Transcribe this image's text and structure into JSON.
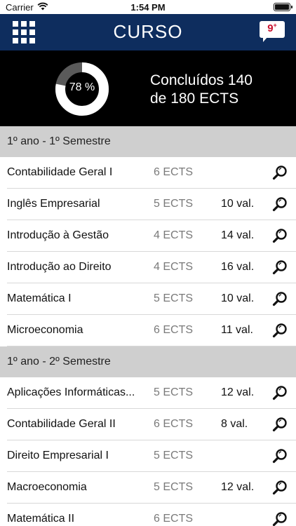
{
  "status_bar": {
    "carrier": "Carrier",
    "time": "1:54 PM"
  },
  "nav": {
    "title": "CURSO",
    "notification_count": "9",
    "notification_suffix": "+"
  },
  "progress": {
    "percent_label": "78 %",
    "percent": 78,
    "line1": "Concluídos 140",
    "line2": "de 180 ECTS"
  },
  "sections": [
    {
      "title": "1º ano - 1º Semestre",
      "courses": [
        {
          "name": "Contabilidade Geral I",
          "ects": "6 ECTS",
          "grade": ""
        },
        {
          "name": "Inglês Empresarial",
          "ects": "5 ECTS",
          "grade": "10 val."
        },
        {
          "name": "Introdução à Gestão",
          "ects": "4 ECTS",
          "grade": "14 val."
        },
        {
          "name": "Introdução ao Direito",
          "ects": "4 ECTS",
          "grade": "16 val."
        },
        {
          "name": "Matemática I",
          "ects": "5 ECTS",
          "grade": "10 val."
        },
        {
          "name": "Microeconomia",
          "ects": "6 ECTS",
          "grade": "11 val."
        }
      ]
    },
    {
      "title": "1º ano - 2º Semestre",
      "courses": [
        {
          "name": "Aplicações Informáticas...",
          "ects": "5 ECTS",
          "grade": "12 val."
        },
        {
          "name": "Contabilidade Geral II",
          "ects": "6 ECTS",
          "grade": "8 val."
        },
        {
          "name": "Direito Empresarial I",
          "ects": "5 ECTS",
          "grade": ""
        },
        {
          "name": "Macroeconomia",
          "ects": "5 ECTS",
          "grade": "12 val."
        },
        {
          "name": "Matemática II",
          "ects": "6 ECTS",
          "grade": ""
        }
      ]
    }
  ],
  "colors": {
    "nav_bg": "#0e2d5e",
    "hero_bg": "#000000",
    "section_bg": "#cfcfcf",
    "notif_red": "#c8102e"
  }
}
